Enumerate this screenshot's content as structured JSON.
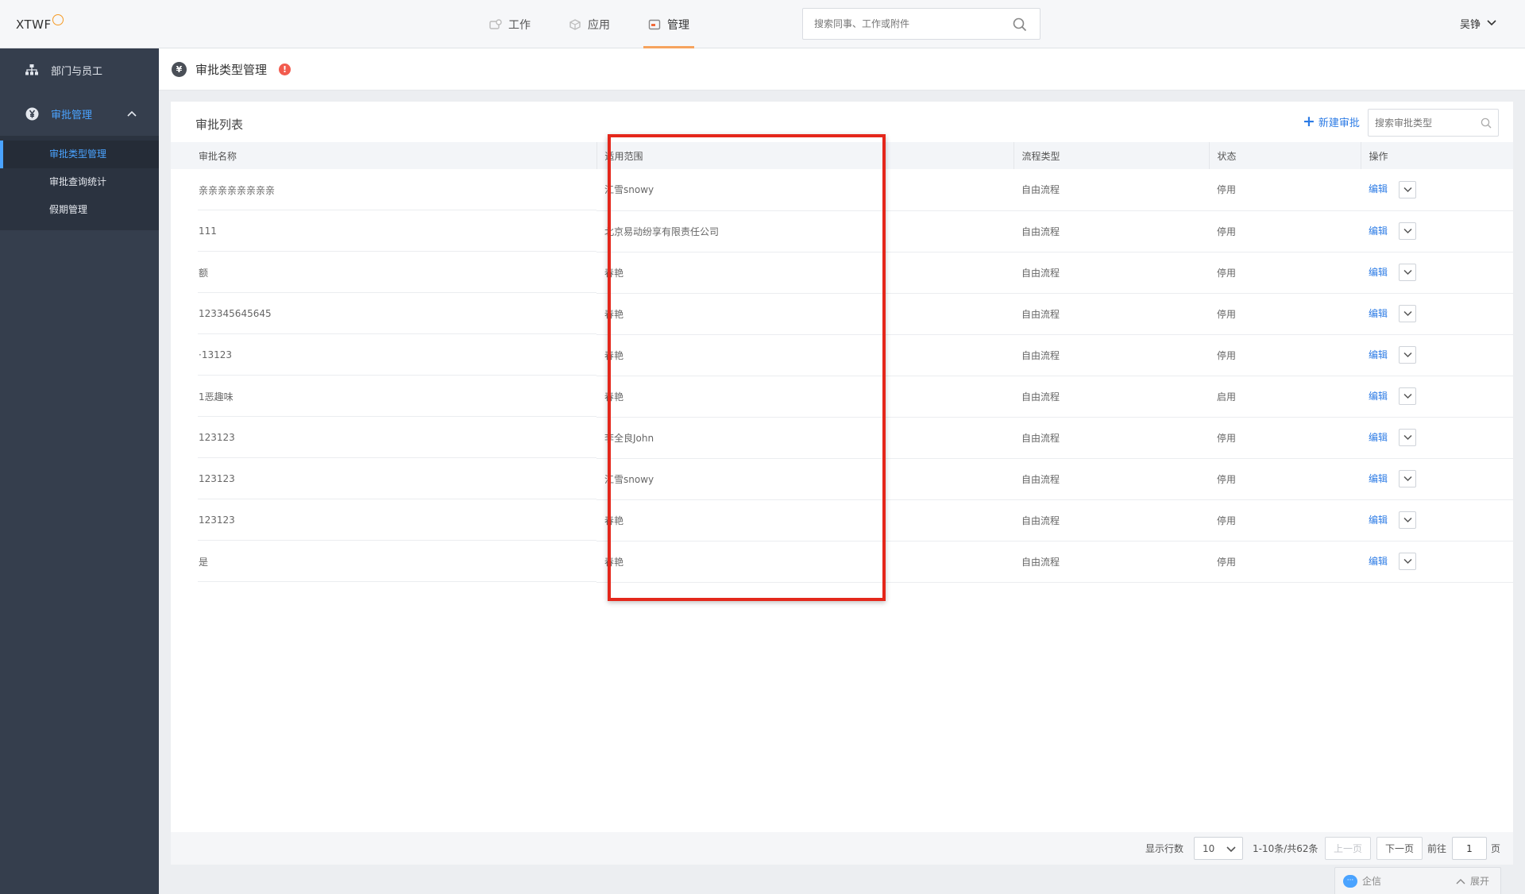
{
  "app": {
    "logo": "XTWF"
  },
  "topnav": [
    {
      "label": "工作",
      "icon": "work-icon",
      "active": false
    },
    {
      "label": "应用",
      "icon": "apps-icon",
      "active": false
    },
    {
      "label": "管理",
      "icon": "manage-icon",
      "active": true
    }
  ],
  "search": {
    "placeholder": "搜索同事、工作或附件"
  },
  "user": {
    "name": "吴铮"
  },
  "sidebar": {
    "items": [
      {
        "label": "部门与员工",
        "icon": "org-chart-icon"
      },
      {
        "label": "审批管理",
        "icon": "yen-icon",
        "expanded": true
      }
    ],
    "sub_items": [
      {
        "label": "审批类型管理",
        "active": true
      },
      {
        "label": "审批查询统计",
        "active": false
      },
      {
        "label": "假期管理",
        "active": false
      }
    ]
  },
  "page": {
    "title": "审批类型管理",
    "alert_glyph": "!"
  },
  "card": {
    "title": "审批列表",
    "new_button": "新建审批",
    "search_placeholder": "搜索审批类型"
  },
  "table": {
    "columns": [
      "审批名称",
      "适用范围",
      "流程类型",
      "状态",
      "操作"
    ],
    "edit_label": "编辑",
    "rows": [
      {
        "name": "亲亲亲亲亲亲亲亲",
        "scope": "江雪snowy",
        "flow": "自由流程",
        "status": "停用"
      },
      {
        "name": "111",
        "scope": "北京易动纷享有限责任公司",
        "flow": "自由流程",
        "status": "停用"
      },
      {
        "name": "额",
        "scope": "春艳",
        "flow": "自由流程",
        "status": "停用"
      },
      {
        "name": "123345645645",
        "scope": "春艳",
        "flow": "自由流程",
        "status": "停用"
      },
      {
        "name": "·13123",
        "scope": "春艳",
        "flow": "自由流程",
        "status": "停用"
      },
      {
        "name": "1恶趣味",
        "scope": "春艳",
        "flow": "自由流程",
        "status": "启用"
      },
      {
        "name": "123123",
        "scope": "李全良John",
        "flow": "自由流程",
        "status": "停用"
      },
      {
        "name": "123123",
        "scope": "江雪snowy",
        "flow": "自由流程",
        "status": "停用"
      },
      {
        "name": "123123",
        "scope": "春艳",
        "flow": "自由流程",
        "status": "停用"
      },
      {
        "name": "是",
        "scope": "春艳",
        "flow": "自由流程",
        "status": "停用"
      }
    ]
  },
  "pagination": {
    "rows_label": "显示行数",
    "rows_value": "10",
    "range": "1-10条/共62条",
    "prev": "上一页",
    "next": "下一页",
    "goto_label": "前往",
    "page_value": "1",
    "page_unit": "页"
  },
  "chat": {
    "label": "企信",
    "expand": "展开"
  },
  "colors": {
    "accent": "#2c7be5",
    "highlight": "#e4271b",
    "sidebar": "#353e4d",
    "nav_active": "#f6a35e"
  }
}
